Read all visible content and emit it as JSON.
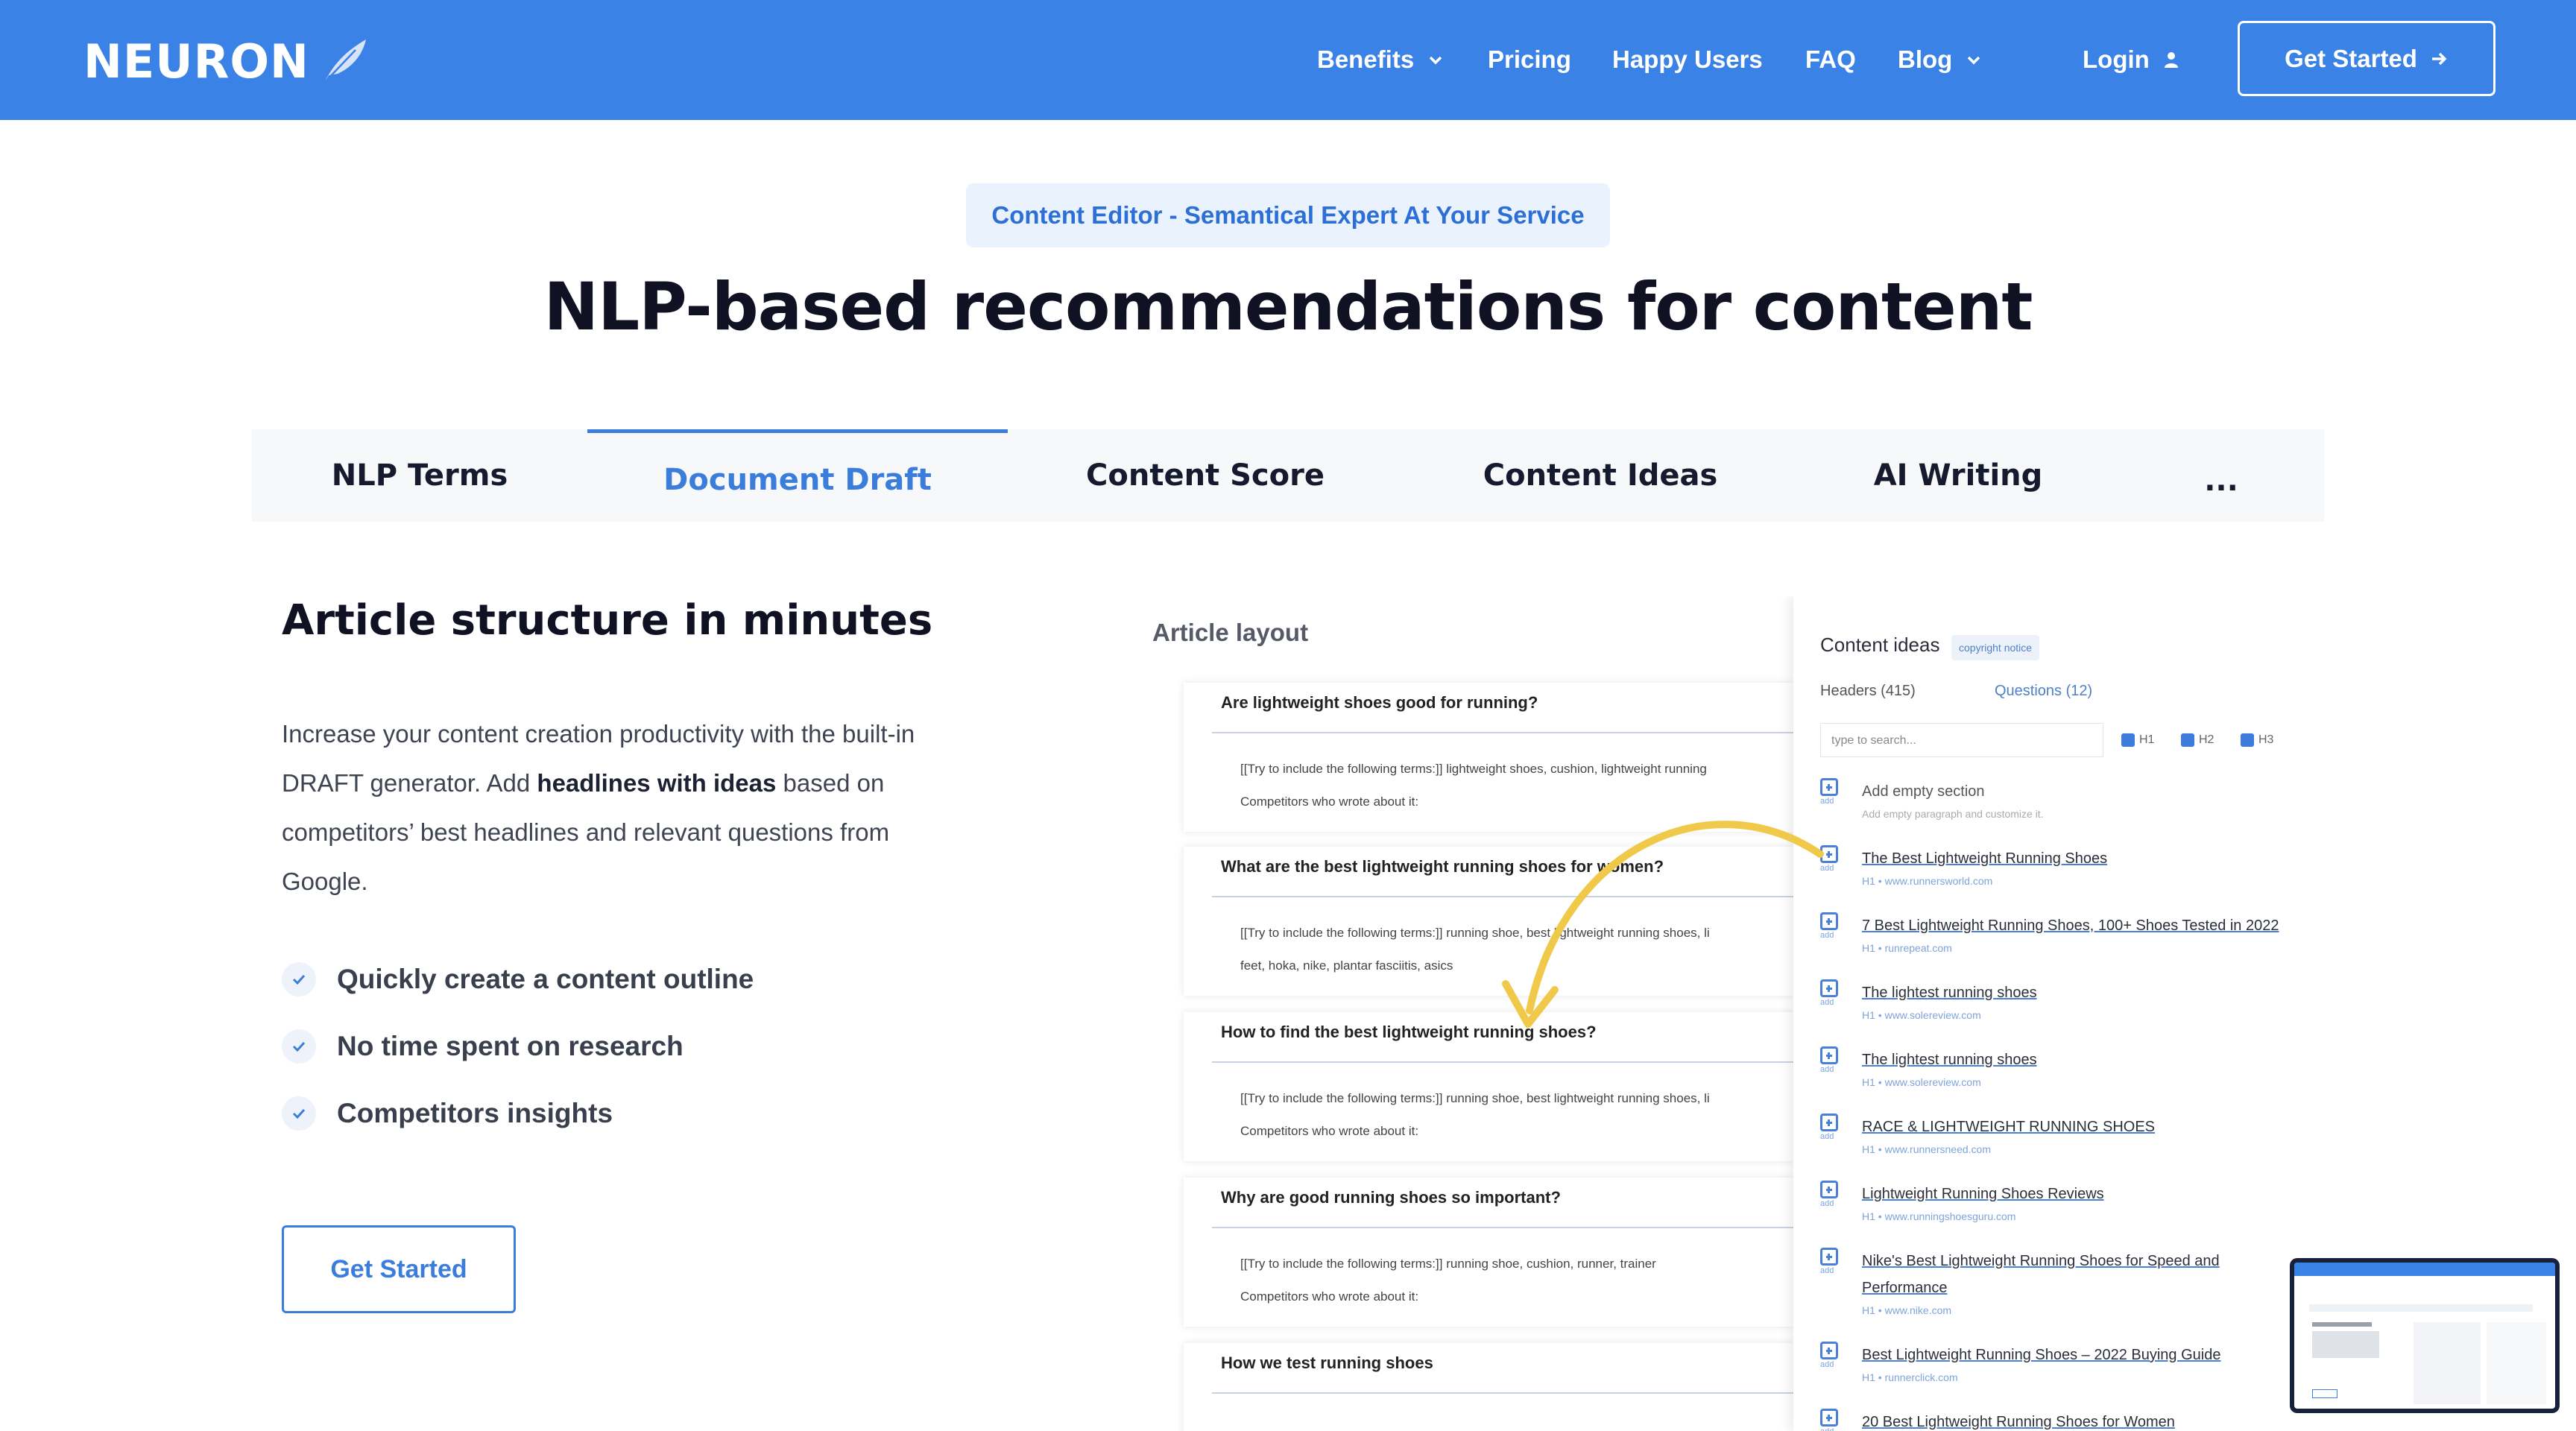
{
  "nav": {
    "logo": "NEURON",
    "items": [
      {
        "label": "Benefits"
      },
      {
        "label": "Pricing"
      },
      {
        "label": "Happy Users"
      },
      {
        "label": "FAQ"
      },
      {
        "label": "Blog"
      }
    ],
    "login": "Login",
    "get_started": "Get Started"
  },
  "hero": {
    "badge": "Content Editor - Semantical Expert At Your Service",
    "title": "NLP-based recommendations for content"
  },
  "tabs": [
    {
      "label": "NLP Terms"
    },
    {
      "label": "Document Draft"
    },
    {
      "label": "Content Score"
    },
    {
      "label": "Content Ideas"
    },
    {
      "label": "AI Writing"
    },
    {
      "label": "..."
    }
  ],
  "active_tab": "Document Draft",
  "section": {
    "title": "Article structure in minutes",
    "desc_1": "Increase your content creation productivity with the built-in DRAFT generator. Add ",
    "desc_bold": "headlines with ideas",
    "desc_2": " based on competitors’ best headlines and relevant questions from Google.",
    "features": [
      "Quickly create a content outline",
      "No time spent on research",
      "Competitors insights"
    ],
    "cta": "Get Started"
  },
  "mockup": {
    "layout_label": "Article layout",
    "cards": [
      {
        "q": "Are lightweight shoes good for running?",
        "t1": "[[Try to include the following terms:]] lightweight shoes, cushion, lightweight running",
        "t2": "Competitors who wrote about it:"
      },
      {
        "q": "What are the best lightweight running shoes for women?",
        "t1": "[[Try to include the following terms:]] running shoe, best lightweight running shoes, li",
        "t2": "feet, hoka, nike, plantar fasciitis, asics"
      },
      {
        "q": "How to find the best lightweight running shoes?",
        "t1": "[[Try to include the following terms:]] running shoe, best lightweight running shoes, li",
        "t2": "Competitors who wrote about it:"
      },
      {
        "q": "Why are good running shoes so important?",
        "t1": "[[Try to include the following terms:]] running shoe, cushion, runner, trainer",
        "t2": "Competitors who wrote about it:"
      },
      {
        "q": "How we test running shoes",
        "t1": "",
        "t2": ""
      }
    ],
    "ideas": {
      "title": "Content ideas",
      "notice": "copyright notice",
      "headers_tab": "Headers (415)",
      "questions_tab": "Questions (12)",
      "search_placeholder": "type to search...",
      "h_filters": [
        "H1",
        "H2",
        "H3"
      ],
      "add_label": "add",
      "items": [
        {
          "title": "Add empty section",
          "url": "Add empty paragraph and customize it."
        },
        {
          "title": "The Best Lightweight Running Shoes",
          "url": "H1 • www.runnersworld.com"
        },
        {
          "title": "7 Best Lightweight Running Shoes, 100+ Shoes Tested in 2022",
          "url": "H1 • runrepeat.com"
        },
        {
          "title": "The lightest running shoes",
          "url": "H1 • www.solereview.com"
        },
        {
          "title": "The lightest running shoes",
          "url": "H1 • www.solereview.com"
        },
        {
          "title": "RACE & LIGHTWEIGHT RUNNING SHOES",
          "url": "H1 • www.runnersneed.com"
        },
        {
          "title": "Lightweight Running Shoes Reviews",
          "url": "H1 • www.runningshoesguru.com"
        },
        {
          "title": "Nike's Best Lightweight Running Shoes for Speed and Performance",
          "url": "H1 • www.nike.com"
        },
        {
          "title": "Best Lightweight Running Shoes – 2022 Buying Guide",
          "url": "H1 • runnerclick.com"
        },
        {
          "title": "20 Best Lightweight Running Shoes for Women",
          "url": ""
        }
      ]
    }
  },
  "colors": {
    "brand": "#3b82e6",
    "accent": "#3b7ddb",
    "badge_bg": "#eaf3fd"
  }
}
